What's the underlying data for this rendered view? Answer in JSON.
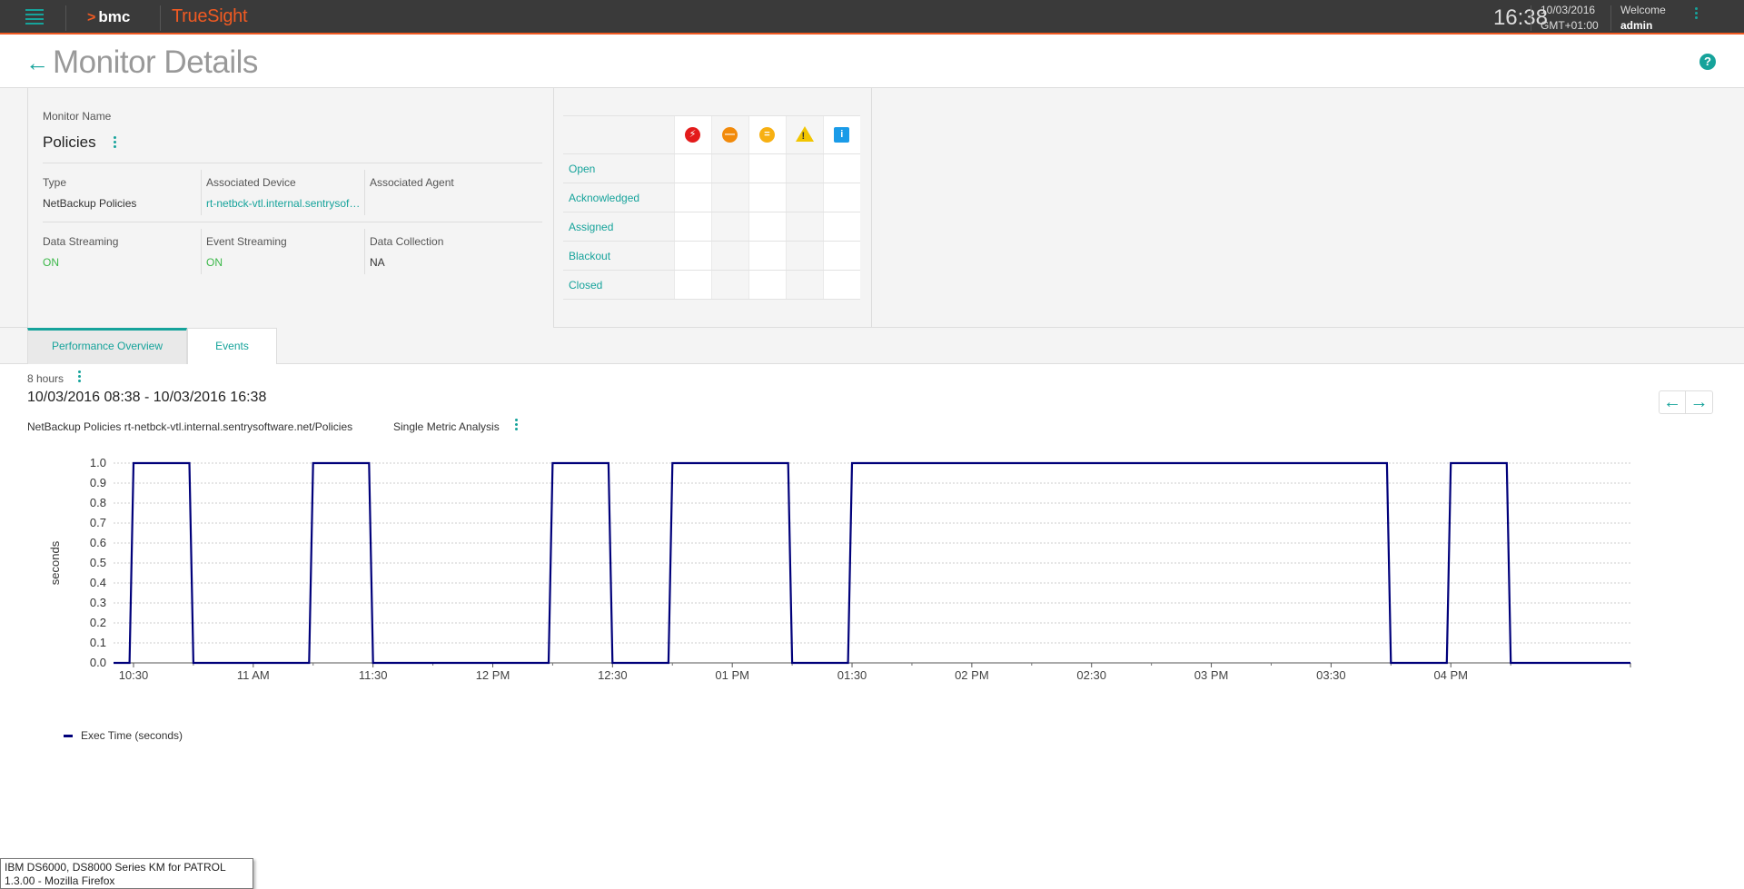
{
  "topbar": {
    "brand": "bmc",
    "product": "TrueSight",
    "time": "16:38",
    "date": "10/03/2016",
    "timezone": "GMT+01:00",
    "welcome": "Welcome",
    "user": "admin"
  },
  "header": {
    "title": "Monitor Details",
    "help": "?"
  },
  "monitor": {
    "name_label": "Monitor Name",
    "name": "Policies",
    "type_label": "Type",
    "type": "NetBackup Policies",
    "device_label": "Associated Device",
    "device": "rt-netbck-vtl.internal.sentrysoftware.net",
    "agent_label": "Associated Agent",
    "agent": "",
    "data_streaming_label": "Data Streaming",
    "data_streaming": "ON",
    "event_streaming_label": "Event Streaming",
    "event_streaming": "ON",
    "data_collection_label": "Data Collection",
    "data_collection": "NA"
  },
  "events_table": {
    "rows": [
      "Open",
      "Acknowledged",
      "Assigned",
      "Blackout",
      "Closed"
    ],
    "severity_icons": [
      "critical-icon",
      "major-icon",
      "minor-icon",
      "warning-icon",
      "info-icon"
    ]
  },
  "tabs": [
    "Performance Overview",
    "Events"
  ],
  "range": {
    "label": "8 hours",
    "dates": "10/03/2016 08:38 - 10/03/2016 16:38"
  },
  "chart_header": {
    "path": "NetBackup Policies rt-netbck-vtl.internal.sentrysoftware.net/Policies",
    "analysis": "Single Metric Analysis"
  },
  "chart_data": {
    "type": "line",
    "title": "",
    "xlabel": "",
    "ylabel": "seconds",
    "ylim": [
      0,
      1
    ],
    "yticks": [
      "0.0",
      "0.1",
      "0.2",
      "0.3",
      "0.4",
      "0.5",
      "0.6",
      "0.7",
      "0.8",
      "0.9",
      "1.0"
    ],
    "xticks": [
      "10:30",
      "11 AM",
      "11:30",
      "12 PM",
      "12:30",
      "01 PM",
      "01:30",
      "02 PM",
      "02:30",
      "03 PM",
      "03:30",
      "04 PM"
    ],
    "xlim": [
      "10:25",
      "16:45"
    ],
    "grid": true,
    "legend_position": "bottom-left",
    "series": [
      {
        "name": "Exec Time (seconds)",
        "color": "#00007a",
        "points": [
          [
            "10:25",
            0
          ],
          [
            "10:29",
            0
          ],
          [
            "10:30",
            1
          ],
          [
            "10:44",
            1
          ],
          [
            "10:45",
            0
          ],
          [
            "11:14",
            0
          ],
          [
            "11:15",
            1
          ],
          [
            "11:29",
            1
          ],
          [
            "11:30",
            0
          ],
          [
            "12:14",
            0
          ],
          [
            "12:15",
            1
          ],
          [
            "12:29",
            1
          ],
          [
            "12:30",
            0
          ],
          [
            "12:44",
            0
          ],
          [
            "12:45",
            1
          ],
          [
            "13:14",
            1
          ],
          [
            "13:15",
            0
          ],
          [
            "13:29",
            0
          ],
          [
            "13:30",
            1
          ],
          [
            "15:44",
            1
          ],
          [
            "15:45",
            0
          ],
          [
            "15:59",
            0
          ],
          [
            "16:00",
            1
          ],
          [
            "16:14",
            1
          ],
          [
            "16:15",
            0
          ],
          [
            "16:45",
            0
          ]
        ]
      }
    ]
  },
  "tooltip": "IBM DS6000, DS8000 Series KM for PATROL 1.3.00 - Mozilla Firefox"
}
